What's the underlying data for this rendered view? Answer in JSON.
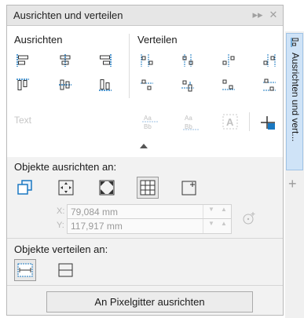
{
  "panel": {
    "title": "Ausrichten und verteilen",
    "title_buttons": {
      "collapse": "▸▸",
      "close": "✕"
    }
  },
  "align": {
    "heading": "Ausrichten",
    "icons": [
      "align-left-icon",
      "align-center-horizontal-icon",
      "align-right-icon",
      "align-top-icon",
      "align-center-vertical-icon",
      "align-bottom-icon"
    ]
  },
  "distribute": {
    "heading": "Verteilen",
    "icons": [
      "distribute-left-icon",
      "distribute-center-horizontal-icon",
      "distribute-spacing-horizontal-icon",
      "distribute-right-icon",
      "distribute-top-icon",
      "distribute-center-vertical-icon",
      "distribute-spacing-vertical-icon",
      "distribute-bottom-icon"
    ]
  },
  "text_row": {
    "label": "Text",
    "icon_labels": [
      "Aa\nBb",
      "Aa\nBb",
      "A"
    ]
  },
  "align_to": {
    "heading": "Objekte ausrichten an:",
    "options": [
      "active-objects-icon",
      "page-edge-icon",
      "page-center-icon",
      "grid-icon",
      "specified-point-icon"
    ],
    "selected": "grid-icon"
  },
  "coords": {
    "x_label": "X:",
    "x_value": "79,084 mm",
    "y_label": "Y:",
    "y_value": "117,917 mm"
  },
  "distribute_to": {
    "heading": "Objekte verteilen an:",
    "options": [
      "selection-extent-icon",
      "page-extent-icon"
    ],
    "selected": "selection-extent-icon"
  },
  "snap_button": {
    "label": "An Pixelgitter ausrichten"
  },
  "side_tab": {
    "label": "Ausrichten und vert..."
  },
  "colors": {
    "accent": "#1a78c2",
    "tab_bg": "#cfe3f7"
  }
}
